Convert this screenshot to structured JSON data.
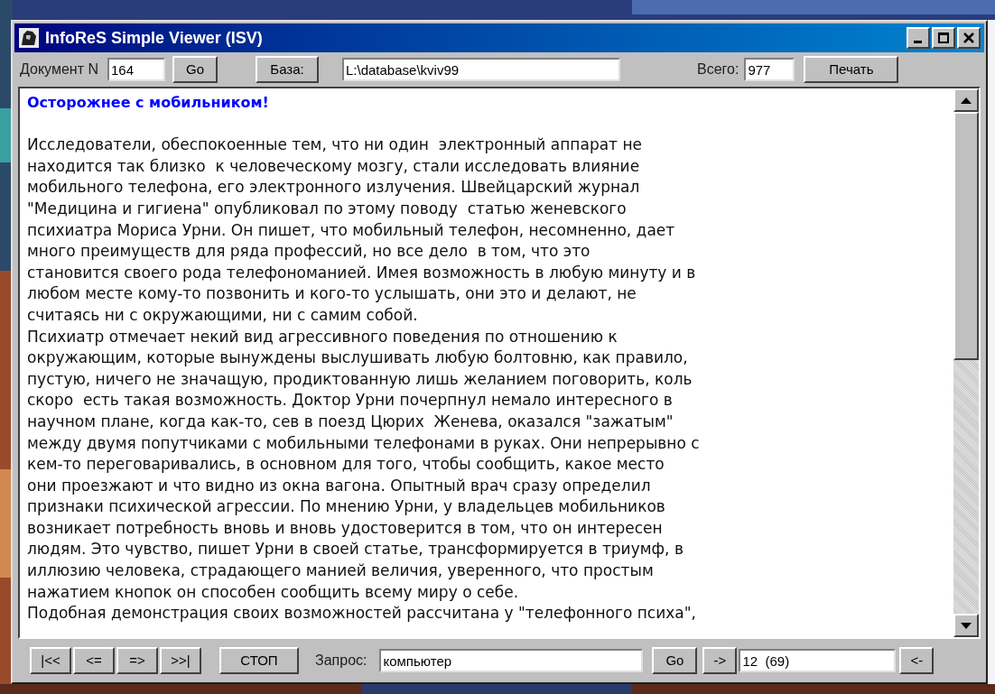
{
  "window": {
    "title": "InfoReS Simple Viewer (ISV)"
  },
  "toolbar": {
    "doc_label": "Документ N",
    "doc_number": "164",
    "go_button": "Go",
    "base_button": "База:",
    "base_path": "L:\\database\\kviv99",
    "total_label": "Всего:",
    "total": "977",
    "print_button": "Печать"
  },
  "document": {
    "title": "Осторожнее с мобильником!",
    "lines": [
      "Исследователи, обеспокоенные тем, что ни один  электронный аппарат не",
      "находится так близко  к человеческому мозгу, стали исследовать влияние",
      "мобильного телефона, его электронного излучения. Швейцарский журнал",
      "\"Медицина и гигиена\" опубликовал по этому поводу  статью женевского",
      "психиатра Мориса Урни. Он пишет, что мобильный телефон, несомненно, дает",
      "много преимуществ для ряда профессий, но все дело  в том, что это",
      "становится своего рода телефономанией. Имея возможность в любую минуту и в",
      "любом месте кому-то позвонить и кого-то услышать, они это и делают, не",
      "считаясь ни с окружающими, ни с самим собой.",
      "Психиатр отмечает некий вид агрессивного поведения по отношению к",
      "окружающим, которые вынуждены выслушивать любую болтовню, как правило,",
      "пустую, ничего не значащую, продиктованную лишь желанием поговорить, коль",
      "скоро  есть такая возможность. Доктор Урни почерпнул немало интересного в",
      "научном плане, когда как-то, сев в поезд Цюрих  Женева, оказался \"зажатым\"",
      "между двумя попутчиками с мобильными телефонами в руках. Они непрерывно с",
      "кем-то переговаривались, в основном для того, чтобы сообщить, какое место",
      "они проезжают и что видно из окна вагона. Опытный врач сразу определил",
      "признаки психической агрессии. По мнению Урни, у владельцев мобильников",
      "возникает потребность вновь и вновь удостоверится в том, что он интересен",
      "людям. Это чувство, пишет Урни в своей статье, трансформируется в триумф, в",
      "иллюзию человека, страдающего манией величия, уверенного, что простым",
      "нажатием кнопок он способен сообщить всему миру о себе.",
      "Подобная демонстрация своих возможностей рассчитана у \"телефонного психа\","
    ]
  },
  "bottom_bar": {
    "nav_buttons": [
      "|<<",
      "<=",
      "=>",
      ">>|"
    ],
    "stop_button": "СТОП",
    "query_label": "Запрос:",
    "query": "компьютер",
    "go_button": "Go",
    "next_button": "->",
    "hits": "12  (69)",
    "prev_button": "<-"
  }
}
